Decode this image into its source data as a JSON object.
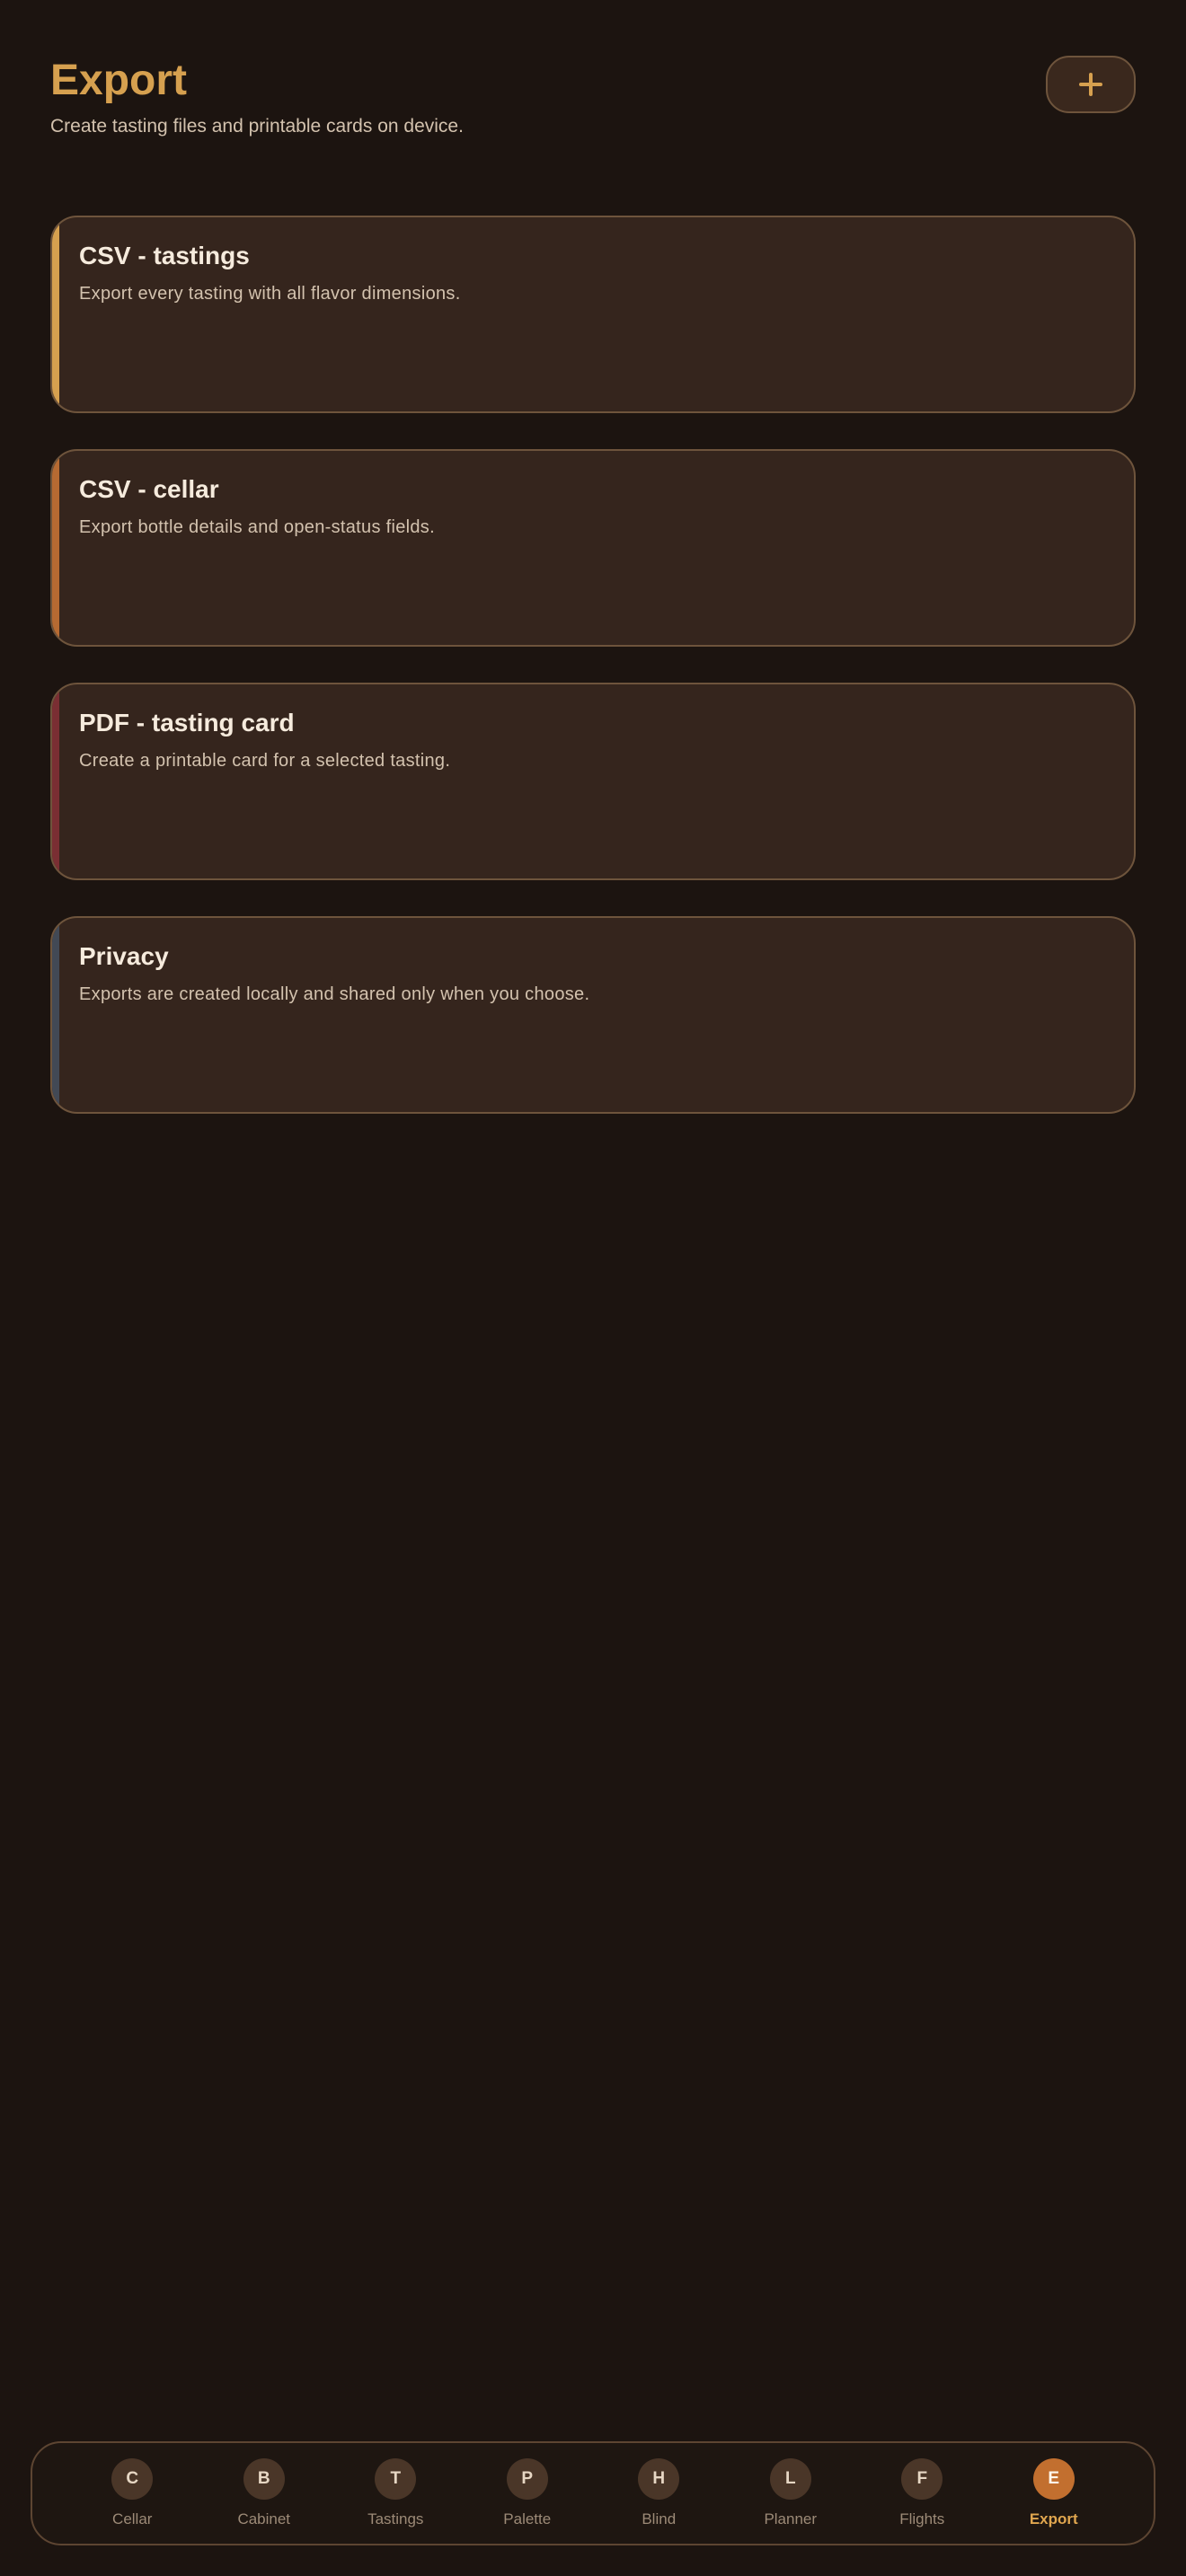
{
  "header": {
    "title": "Export",
    "subtitle": "Create tasting files and printable cards on device.",
    "add_button_icon": "plus-icon"
  },
  "cards": [
    {
      "title": "CSV - tastings",
      "description": "Export every tasting with all flavor dimensions.",
      "accent_color": "#d6a04f"
    },
    {
      "title": "CSV - cellar",
      "description": "Export bottle details and open-status fields.",
      "accent_color": "#b66a32"
    },
    {
      "title": "PDF - tasting card",
      "description": "Create a printable card for a selected tasting.",
      "accent_color": "#7a2e33"
    },
    {
      "title": "Privacy",
      "description": "Exports are created locally and shared only when you choose.",
      "accent_color": "#424955"
    }
  ],
  "nav": {
    "active": "Export",
    "items": [
      {
        "initial": "C",
        "label": "Cellar"
      },
      {
        "initial": "B",
        "label": "Cabinet"
      },
      {
        "initial": "T",
        "label": "Tastings"
      },
      {
        "initial": "P",
        "label": "Palette"
      },
      {
        "initial": "H",
        "label": "Blind"
      },
      {
        "initial": "L",
        "label": "Planner"
      },
      {
        "initial": "F",
        "label": "Flights"
      },
      {
        "initial": "E",
        "label": "Export"
      }
    ]
  },
  "colors": {
    "background": "#1c1410",
    "card": "#35251d",
    "brand": "#d6a04f",
    "active_nav": "#c26f2f"
  }
}
